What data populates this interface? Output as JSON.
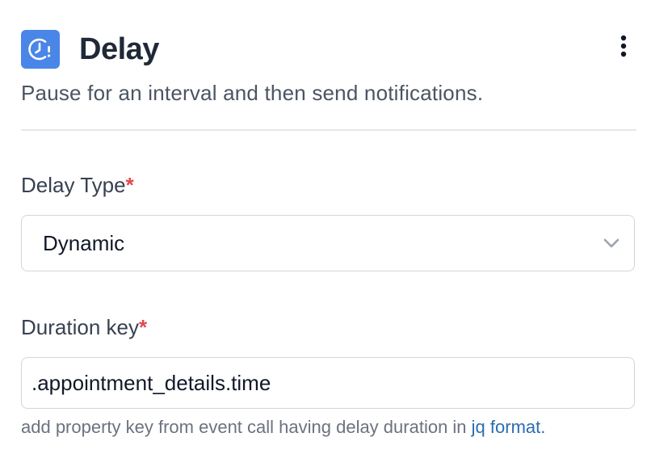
{
  "header": {
    "icon": "clock-alert-icon",
    "title": "Delay",
    "menu_icon": "more-vertical-icon",
    "subtitle": "Pause for an interval and then send notifications."
  },
  "delay_type": {
    "label": "Delay Type",
    "required_marker": "*",
    "selected_value": "Dynamic",
    "chevron_icon": "chevron-down-icon"
  },
  "duration_key": {
    "label": "Duration key",
    "required_marker": "*",
    "value": ".appointment_details.time",
    "help_text": "add property key from event call having delay duration in ",
    "help_link": "jq format."
  },
  "colors": {
    "accent": "#4a86e8",
    "required": "#e0484b",
    "link": "#2b6cb0"
  }
}
